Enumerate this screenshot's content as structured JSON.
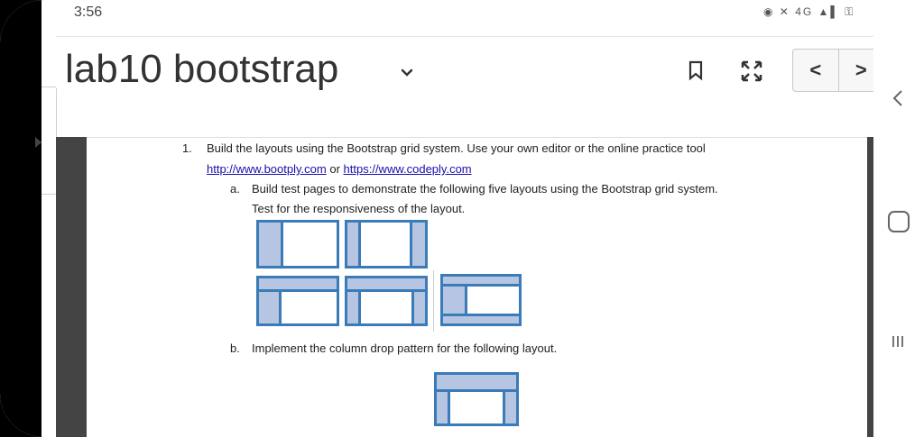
{
  "status_bar": {
    "time": "3:56",
    "icons_text": "◉ ✕ 4G ▲▌ ⚿"
  },
  "header": {
    "title": "lab10 bootstrap"
  },
  "colors": {
    "accent": "#3a7bb8",
    "fill": "#b6c5e2",
    "text": "#222222"
  },
  "icons": {
    "bookmark": "bookmark-icon",
    "expand": "expand-icon",
    "prev": "chevron-left-icon",
    "next": "chevron-right-icon",
    "back": "back-icon",
    "home": "home-icon",
    "recents": "recents-icon"
  },
  "nav": {
    "prev_label": "<",
    "next_label": ">"
  },
  "document": {
    "item1_number": "1.",
    "item1_text": "Build the layouts using the Bootstrap grid system. Use your own editor or the online practice tool",
    "link1": "http://www.bootply.com",
    "or_text": "or",
    "link2": "https://www.codeply.com",
    "sub_a_label": "a.",
    "sub_a_text_line1": "Build test pages to demonstrate the following five layouts using the Bootstrap grid system.",
    "sub_a_text_line2": "Test for the responsiveness of the layout.",
    "sub_b_label": "b.",
    "sub_b_text": "Implement the column drop pattern for the following layout."
  }
}
